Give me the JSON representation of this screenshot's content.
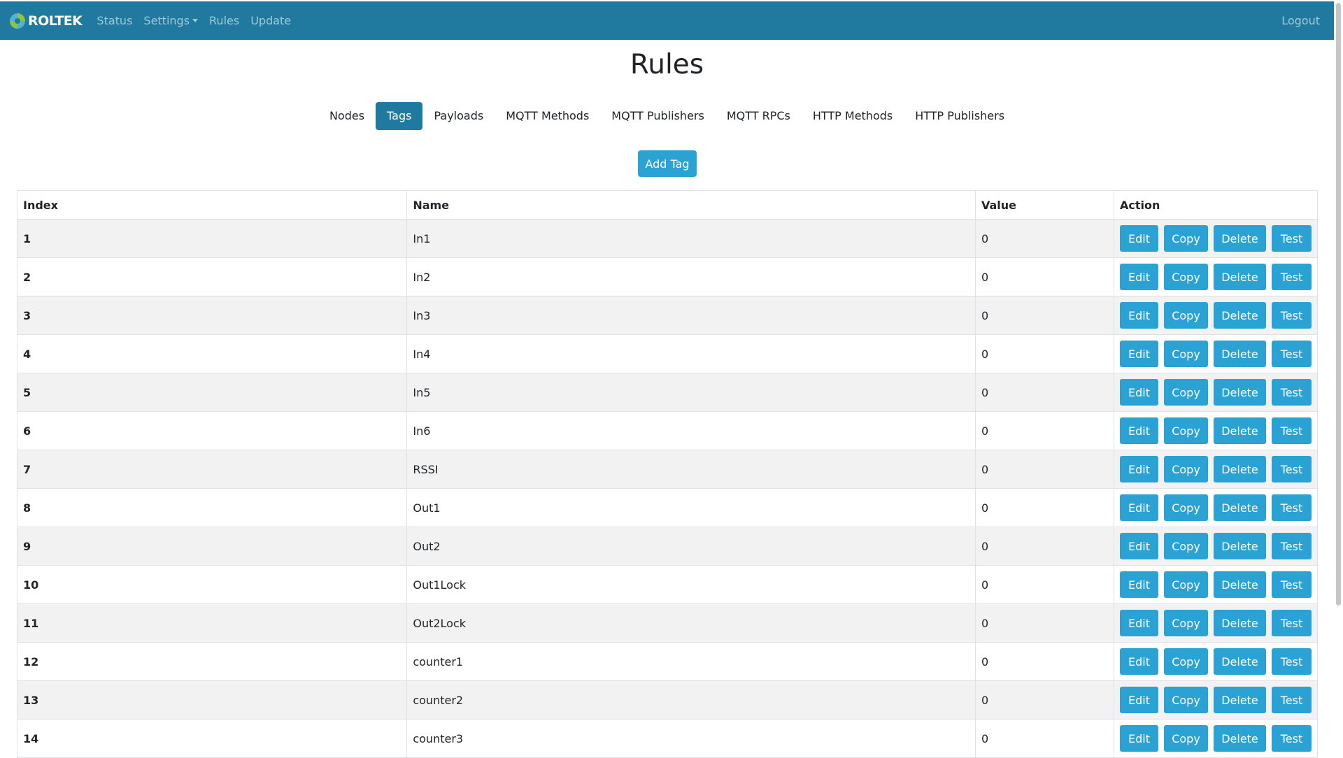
{
  "navbar": {
    "brand": "ROLTEK",
    "links": [
      "Status",
      "Settings",
      "Rules",
      "Update"
    ],
    "logout": "Logout"
  },
  "page": {
    "title": "Rules"
  },
  "tabs": [
    "Nodes",
    "Tags",
    "Payloads",
    "MQTT Methods",
    "MQTT Publishers",
    "MQTT RPCs",
    "HTTP Methods",
    "HTTP Publishers"
  ],
  "active_tab": "Tags",
  "add_button": "Add Tag",
  "table": {
    "headers": [
      "Index",
      "Name",
      "Value",
      "Action"
    ],
    "action_labels": [
      "Edit",
      "Copy",
      "Delete",
      "Test"
    ],
    "rows": [
      {
        "index": "1",
        "name": "In1",
        "value": "0"
      },
      {
        "index": "2",
        "name": "In2",
        "value": "0"
      },
      {
        "index": "3",
        "name": "In3",
        "value": "0"
      },
      {
        "index": "4",
        "name": "In4",
        "value": "0"
      },
      {
        "index": "5",
        "name": "In5",
        "value": "0"
      },
      {
        "index": "6",
        "name": "In6",
        "value": "0"
      },
      {
        "index": "7",
        "name": "RSSI",
        "value": "0"
      },
      {
        "index": "8",
        "name": "Out1",
        "value": "0"
      },
      {
        "index": "9",
        "name": "Out2",
        "value": "0"
      },
      {
        "index": "10",
        "name": "Out1Lock",
        "value": "0"
      },
      {
        "index": "11",
        "name": "Out2Lock",
        "value": "0"
      },
      {
        "index": "12",
        "name": "counter1",
        "value": "0"
      },
      {
        "index": "13",
        "name": "counter2",
        "value": "0"
      },
      {
        "index": "14",
        "name": "counter3",
        "value": "0"
      }
    ]
  },
  "colors": {
    "navbar": "#20799e",
    "button": "#2aa3d4",
    "active_tab": "#20799e",
    "row_stripe": "#f2f2f2"
  },
  "icons": {
    "brand_logo": "roltek-logo-icon",
    "settings_dropdown": "caret-down-icon"
  }
}
